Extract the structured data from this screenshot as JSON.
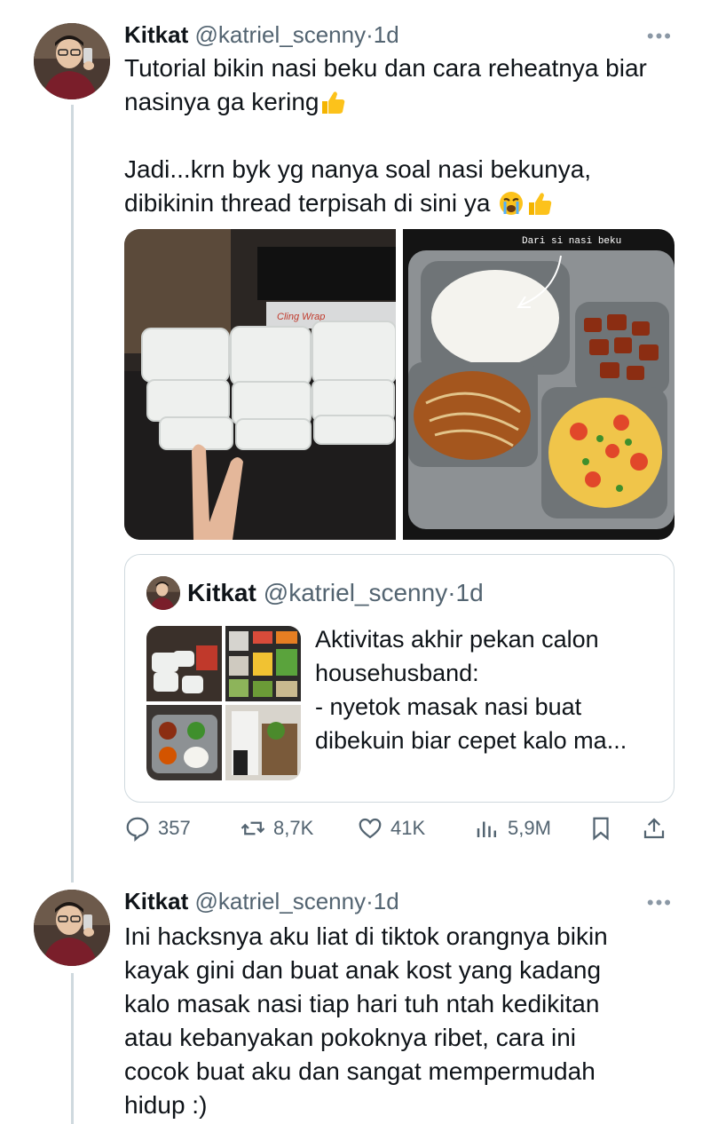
{
  "tweets": [
    {
      "name": "Kitkat",
      "handle": "@katriel_scenny",
      "dot": "·",
      "time": "1d",
      "more": "•••",
      "text_lines": [
        "Tutorial bikin nasi beku dan cara reheatnya biar",
        "nasinya ga kering",
        "",
        "Jadi...krn byk yg nanya soal nasi bekunya,",
        "dibikinin thread terpisah di sini ya"
      ],
      "media_caption": "Dari si nasi beku",
      "media_wrap_label": "Cling Wrap",
      "quote": {
        "name": "Kitkat",
        "handle": "@katriel_scenny",
        "dot": "·",
        "time": "1d",
        "text_lines": [
          "Aktivitas akhir pekan calon",
          "househusband:",
          "- nyetok masak nasi buat",
          "dibekuin biar cepet kalo ma..."
        ]
      },
      "actions": {
        "replies": "357",
        "retweets": "8,7K",
        "likes": "41K",
        "views": "5,9M"
      }
    },
    {
      "name": "Kitkat",
      "handle": "@katriel_scenny",
      "dot": "·",
      "time": "1d",
      "more": "•••",
      "text_lines": [
        "Ini hacksnya aku liat di tiktok orangnya bikin",
        "kayak gini dan buat anak kost yang kadang",
        "kalo masak nasi tiap hari tuh ntah kedikitan",
        "atau kebanyakan pokoknya ribet, cara ini",
        "cocok buat aku dan sangat mempermudah",
        "hidup :)"
      ]
    }
  ],
  "colors": {
    "text": "#0f1419",
    "secondary": "#536471",
    "thread_line": "#cfd9de",
    "border": "#cfd9de"
  },
  "icons": [
    "thumbs-up-emoji",
    "crying-face-emoji",
    "reply-icon",
    "retweet-icon",
    "like-icon",
    "views-icon",
    "bookmark-icon",
    "share-icon",
    "more-icon"
  ]
}
